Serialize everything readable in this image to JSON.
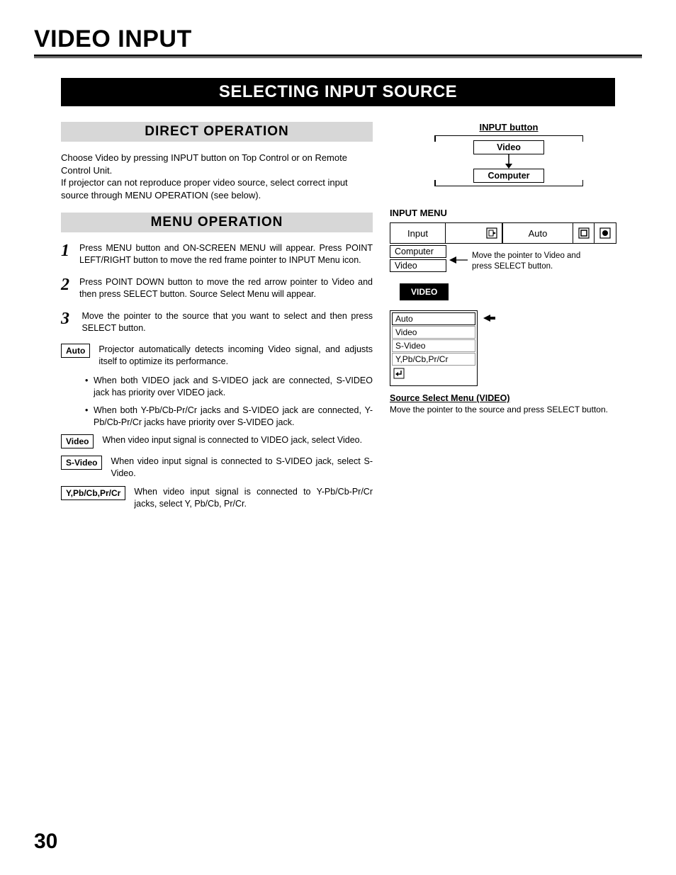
{
  "page": {
    "title": "VIDEO INPUT",
    "section_banner": "SELECTING INPUT SOURCE",
    "number": "30"
  },
  "direct": {
    "heading": "DIRECT OPERATION",
    "text": "Choose Video by pressing INPUT button on Top Control or on Remote Control Unit.\nIf projector can not reproduce proper video source, select correct input source through MENU OPERATION (see below)."
  },
  "menu": {
    "heading": "MENU OPERATION",
    "steps": [
      "Press MENU button and ON-SCREEN MENU will appear. Press POINT LEFT/RIGHT button to move the red frame pointer to INPUT Menu icon.",
      "Press POINT DOWN button to move the red arrow pointer to Video and then press SELECT button. Source Select Menu will appear.",
      "Move the pointer to the source that you want to select and then press SELECT button."
    ],
    "boxes": [
      {
        "label": "Auto",
        "desc": "Projector automatically detects incoming Video signal, and adjusts itself to optimize its performance.",
        "bullets": [
          "When both VIDEO jack and S-VIDEO jack are connected, S-VIDEO jack has priority over VIDEO jack.",
          "When both Y-Pb/Cb-Pr/Cr jacks and S-VIDEO jack are connected, Y-Pb/Cb-Pr/Cr jacks have priority over S-VIDEO jack."
        ]
      },
      {
        "label": "Video",
        "desc": "When video input signal is connected to VIDEO jack, select Video."
      },
      {
        "label": "S-Video",
        "desc": "When video input signal is connected to S-VIDEO jack, select S-Video."
      },
      {
        "label": "Y,Pb/Cb,Pr/Cr",
        "desc": "When video input signal is connected to Y-Pb/Cb-Pr/Cr jacks, select Y, Pb/Cb, Pr/Cr."
      }
    ]
  },
  "right": {
    "input_button_title": "INPUT button",
    "diagram_top": "Video",
    "diagram_bottom": "Computer",
    "menu_title": "INPUT MENU",
    "osd_input": "Input",
    "osd_auto": "Auto",
    "osd_items_top": [
      "Computer",
      "Video"
    ],
    "annot": "Move the pointer to Video and press SELECT button.",
    "video_tag": "VIDEO",
    "osd_list": [
      "Auto",
      "Video",
      "S-Video",
      "Y,Pb/Cb,Pr/Cr"
    ],
    "caption_title": "Source Select Menu (VIDEO)",
    "caption_text": "Move the pointer to the source and press SELECT button."
  }
}
